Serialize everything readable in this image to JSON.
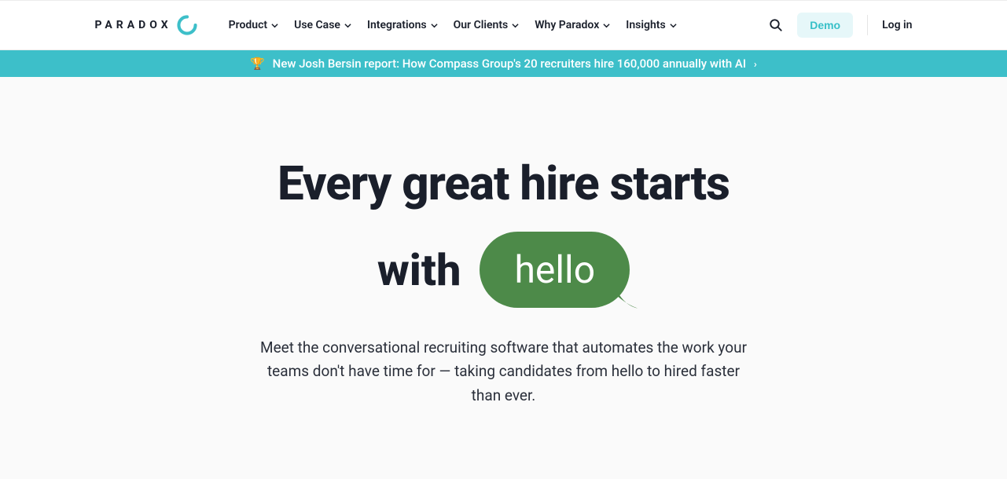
{
  "brand": {
    "name": "PARADOX"
  },
  "nav": {
    "items": [
      {
        "label": "Product"
      },
      {
        "label": "Use Case"
      },
      {
        "label": "Integrations"
      },
      {
        "label": "Our Clients"
      },
      {
        "label": "Why Paradox"
      },
      {
        "label": "Insights"
      }
    ]
  },
  "actions": {
    "demo": "Demo",
    "login": "Log in"
  },
  "banner": {
    "emoji": "🏆",
    "text": "New Josh Bersin report: How Compass Group's 20 recruiters hire 160,000 annually with AI",
    "arrow": "›"
  },
  "hero": {
    "line1": "Every great hire starts",
    "withWord": "with",
    "bubble": "hello",
    "sub": "Meet the conversational recruiting software that automates the work your teams don't have time for — taking candidates from hello to hired faster than ever."
  },
  "colors": {
    "accent": "#3dbfc9",
    "bubble": "#4d8a49"
  }
}
